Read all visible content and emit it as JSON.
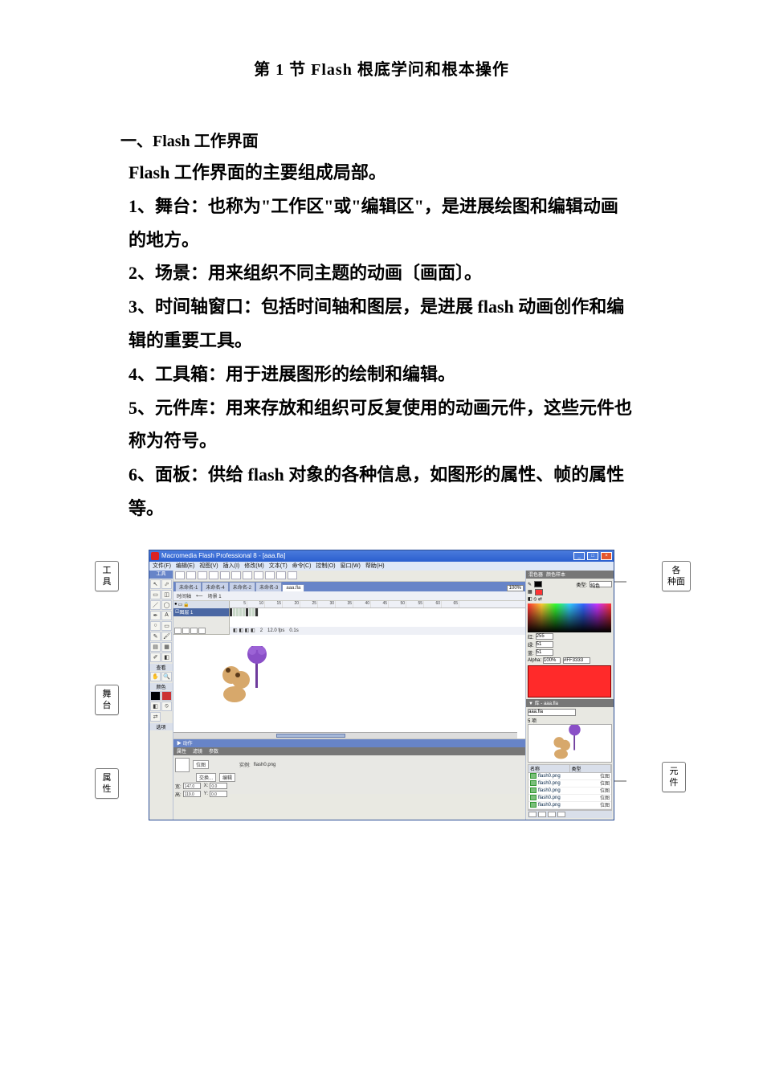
{
  "title": "第 1 节  Flash 根底学问和根本操作",
  "section1": "一、Flash 工作界面",
  "intro": "Flash 工作界面的主要组成局部。",
  "p1": "1、舞台：也称为\"工作区\"或\"编辑区\"，是进展绘图和编辑动画的地方。",
  "p2": "2、场景：用来组织不同主题的动画〔画面〕。",
  "p3": "3、时间轴窗口：包括时间轴和图层，是进展 flash 动画创作和编辑的重要工具。",
  "p4": "4、工具箱：用于进展图形的绘制和编辑。",
  "p5": "5、元件库：用来存放和组织可反复使用的动画元件，这些元件也称为符号。",
  "p6": "6、面板：供给 flash 对象的各种信息，如图形的属性、帧的属性等。",
  "callouts": {
    "tools": "工\n具",
    "stage": "舞\n台",
    "props": "属\n性",
    "panels": "各\n种面",
    "library": "元\n件"
  },
  "flash": {
    "titlebar": "Macromedia Flash Professional 8 - [aaa.fla]",
    "menus": [
      "文件(F)",
      "编辑(E)",
      "视图(V)",
      "插入(I)",
      "修改(M)",
      "文本(T)",
      "命令(C)",
      "控制(O)",
      "窗口(W)",
      "帮助(H)"
    ],
    "tools_header": "工具",
    "tools_sections": {
      "view": "查看",
      "colors": "颜色",
      "options": "选项"
    },
    "tabs": [
      "未命名-1",
      "未命名-4",
      "未命名-2",
      "未命名-3",
      "aaa.fla"
    ],
    "active_tab": "aaa.fla",
    "zoom": "100%",
    "scenebar": {
      "timeline_label": "时间轴",
      "scene": "场景 1"
    },
    "layer": "图层 1",
    "timeline_ticks": [
      "5",
      "10",
      "15",
      "20",
      "25",
      "30",
      "35",
      "40",
      "45",
      "50",
      "55",
      "60",
      "65"
    ],
    "tl_status": {
      "frame": "2",
      "fps": "12.0 fps",
      "time": "0.1s"
    },
    "actions_label": "▶ 动作",
    "props": {
      "tabs": [
        "属性",
        "滤镜",
        "参数"
      ],
      "kind": "位图",
      "instance_label": "实例:",
      "instance": "flash0.png",
      "swap": "交换...",
      "edit": "编辑",
      "W_lbl": "宽:",
      "W": "147.0",
      "H_lbl": "高:",
      "H": "119.0",
      "X_lbl": "X:",
      "X": "0.0",
      "Y_lbl": "Y:",
      "Y": "0.0"
    },
    "color_panel": {
      "title_tab1": "混色器",
      "title_tab2": "颜色样本",
      "type_label": "类型:",
      "type": "纯色",
      "r_label": "红:",
      "r": "255",
      "g_label": "绿:",
      "g": "51",
      "b_label": "蓝:",
      "b": "51",
      "alpha_label": "Alpha:",
      "alpha": "100%",
      "hex": "#FF3333"
    },
    "library": {
      "title": "▼ 库 - aaa.fla",
      "file": "aaa.fla",
      "count": "5 项",
      "cols": {
        "name": "名称",
        "type": "类型"
      },
      "items": [
        {
          "name": "flash0.png",
          "type": "位图"
        },
        {
          "name": "flash0.png",
          "type": "位图"
        },
        {
          "name": "flash0.png",
          "type": "位图"
        },
        {
          "name": "flash0.png",
          "type": "位图"
        },
        {
          "name": "flash0.png",
          "type": "位图"
        }
      ]
    }
  }
}
